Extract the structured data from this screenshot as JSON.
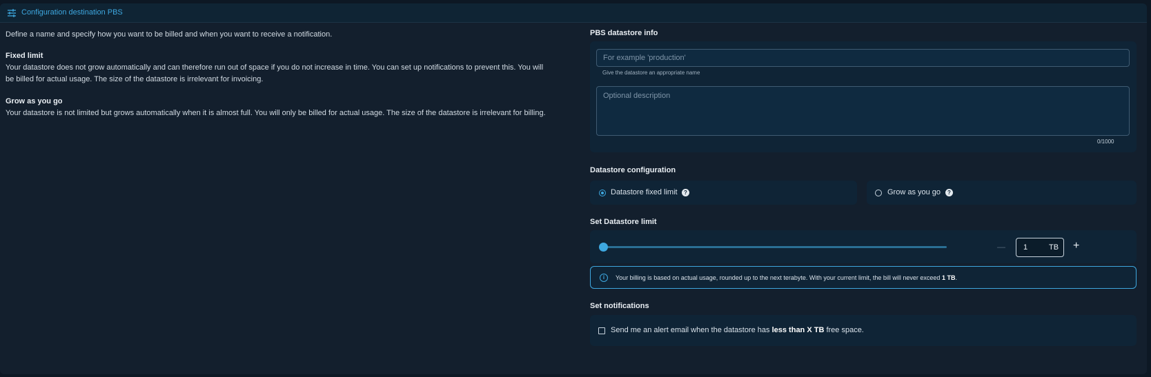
{
  "header": {
    "title": "Configuration destination PBS",
    "icon": "sliders-icon"
  },
  "intro": "Define a name and specify how you want to be billed and when you want to receive a notification.",
  "fixed": {
    "title": "Fixed limit",
    "text": "Your datastore does not grow automatically and can therefore run out of space if you do not increase in time. You can set up notifications to prevent this. You will be billed for actual usage. The size of the datastore is irrelevant for invoicing."
  },
  "grow": {
    "title": "Grow as you go",
    "text": "Your datastore is not limited but grows automatically when it is almost full. You will only be billed for actual usage. The size of the datastore is irrelevant for billing."
  },
  "info_section": {
    "title": "PBS datastore info",
    "name_placeholder": "For example 'production'",
    "name_value": "",
    "name_hint": "Give the datastore an appropriate name",
    "description_placeholder": "Optional description",
    "description_value": "",
    "counter": "0/1000"
  },
  "config_section": {
    "title": "Datastore configuration",
    "options": [
      {
        "label": "Datastore fixed limit",
        "selected": true
      },
      {
        "label": "Grow as you go",
        "selected": false
      }
    ]
  },
  "limit_section": {
    "title": "Set Datastore limit",
    "slider_value": 1,
    "value": "1",
    "unit": "TB",
    "minus": "—",
    "plus": "+",
    "info_text": "Your billing is based on actual usage, rounded up to the next terabyte. With your current limit, the bill will never exceed ",
    "info_bold": "1 TB",
    "info_end": "."
  },
  "notifications": {
    "title": "Set notifications",
    "text_pre": "Send me an alert email when the datastore has ",
    "text_bold": "less than X TB",
    "text_post": " free space.",
    "checked": false
  },
  "colors": {
    "accent": "#3ea8e0",
    "background": "#131f2d",
    "card": "#0f2436"
  }
}
